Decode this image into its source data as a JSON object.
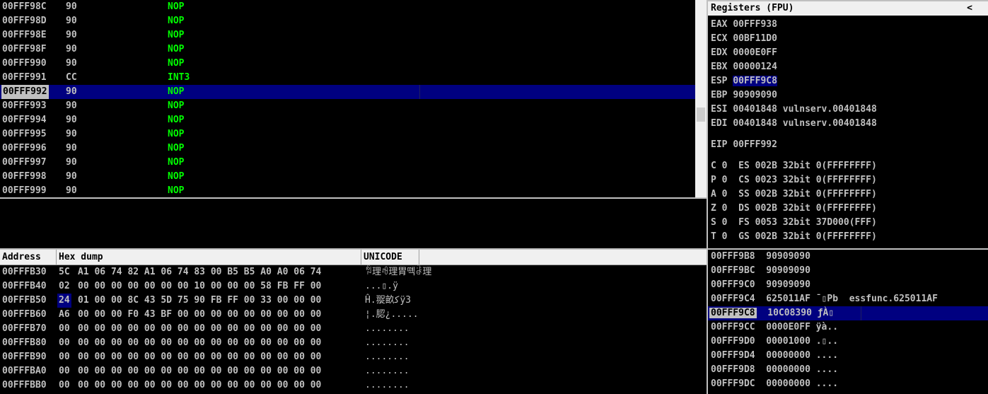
{
  "disasm": {
    "rows": [
      {
        "addr": "00FFF98C",
        "hex": "90",
        "instr": "NOP"
      },
      {
        "addr": "00FFF98D",
        "hex": "90",
        "instr": "NOP"
      },
      {
        "addr": "00FFF98E",
        "hex": "90",
        "instr": "NOP"
      },
      {
        "addr": "00FFF98F",
        "hex": "90",
        "instr": "NOP"
      },
      {
        "addr": "00FFF990",
        "hex": "90",
        "instr": "NOP"
      },
      {
        "addr": "00FFF991",
        "hex": "CC",
        "instr": "INT3"
      },
      {
        "addr": "00FFF992",
        "hex": "90",
        "instr": "NOP"
      },
      {
        "addr": "00FFF993",
        "hex": "90",
        "instr": "NOP"
      },
      {
        "addr": "00FFF994",
        "hex": "90",
        "instr": "NOP"
      },
      {
        "addr": "00FFF995",
        "hex": "90",
        "instr": "NOP"
      },
      {
        "addr": "00FFF996",
        "hex": "90",
        "instr": "NOP"
      },
      {
        "addr": "00FFF997",
        "hex": "90",
        "instr": "NOP"
      },
      {
        "addr": "00FFF998",
        "hex": "90",
        "instr": "NOP"
      },
      {
        "addr": "00FFF999",
        "hex": "90",
        "instr": "NOP"
      }
    ]
  },
  "registers": {
    "title": "Registers (FPU)",
    "collapse": "<",
    "gp": [
      {
        "name": "EAX",
        "value": "00FFF938",
        "comment": ""
      },
      {
        "name": "ECX",
        "value": "00BF11D0",
        "comment": ""
      },
      {
        "name": "EDX",
        "value": "0000E0FF",
        "comment": ""
      },
      {
        "name": "EBX",
        "value": "00000124",
        "comment": ""
      },
      {
        "name": "ESP",
        "value": "00FFF9C8",
        "comment": ""
      },
      {
        "name": "EBP",
        "value": "90909090",
        "comment": ""
      },
      {
        "name": "ESI",
        "value": "00401848",
        "comment": "vulnserv.00401848"
      },
      {
        "name": "EDI",
        "value": "00401848",
        "comment": "vulnserv.00401848"
      }
    ],
    "eip": {
      "name": "EIP",
      "value": "00FFF992"
    },
    "flags": [
      {
        "flag": "C",
        "fval": "0",
        "seg": "ES",
        "sval": "002B",
        "bits": "32bit",
        "range": "0(FFFFFFFF)"
      },
      {
        "flag": "P",
        "fval": "0",
        "seg": "CS",
        "sval": "0023",
        "bits": "32bit",
        "range": "0(FFFFFFFF)"
      },
      {
        "flag": "A",
        "fval": "0",
        "seg": "SS",
        "sval": "002B",
        "bits": "32bit",
        "range": "0(FFFFFFFF)"
      },
      {
        "flag": "Z",
        "fval": "0",
        "seg": "DS",
        "sval": "002B",
        "bits": "32bit",
        "range": "0(FFFFFFFF)"
      },
      {
        "flag": "S",
        "fval": "0",
        "seg": "FS",
        "sval": "0053",
        "bits": "32bit",
        "range": "37D000(FFF)"
      },
      {
        "flag": "T",
        "fval": "0",
        "seg": "GS",
        "sval": "002B",
        "bits": "32bit",
        "range": "0(FFFFFFFF)"
      }
    ]
  },
  "dump": {
    "headers": {
      "address": "Address",
      "hex": "Hex dump",
      "unicode": "UNICODE"
    },
    "rows": [
      {
        "addr": "00FFFB30",
        "first": "5C",
        "rest": "A1 06 74 82 A1 06 74 83 00 B5 B5 A0 A0 06 74",
        "uni": "ꅜ理ꆂ理胃뗵ꂠ理"
      },
      {
        "addr": "00FFFB40",
        "first": "02",
        "rest": "00 00 00 00 00 00 00 10 00 00 00 58 FB FF 00",
        "uni": "...▯.ÿ"
      },
      {
        "addr": "00FFFB50",
        "first": "24",
        "rest": "01 00 00 8C 43 5D 75 90 FB FF 00 33 00 00 00",
        "uni": "Ĥ.䎌畝ﮐÿ3"
      },
      {
        "addr": "00FFFB60",
        "first": "A6",
        "rest": "00 00 00 F0 43 BF 00 00 00 00 00 00 00 00 00",
        "uni": "¦.䏰¿....."
      },
      {
        "addr": "00FFFB70",
        "first": "00",
        "rest": "00 00 00 00 00 00 00 00 00 00 00 00 00 00 00",
        "uni": "........"
      },
      {
        "addr": "00FFFB80",
        "first": "00",
        "rest": "00 00 00 00 00 00 00 00 00 00 00 00 00 00 00",
        "uni": "........"
      },
      {
        "addr": "00FFFB90",
        "first": "00",
        "rest": "00 00 00 00 00 00 00 00 00 00 00 00 00 00 00",
        "uni": "........"
      },
      {
        "addr": "00FFFBA0",
        "first": "00",
        "rest": "00 00 00 00 00 00 00 00 00 00 00 00 00 00 00",
        "uni": "........"
      },
      {
        "addr": "00FFFBB0",
        "first": "00",
        "rest": "00 00 00 00 00 00 00 00 00 00 00 00 00 00 00",
        "uni": "........"
      }
    ]
  },
  "stack": {
    "rows": [
      {
        "addr": "00FFF9B8",
        "value": "90909090",
        "comment": ""
      },
      {
        "addr": "00FFF9BC",
        "value": "90909090",
        "comment": ""
      },
      {
        "addr": "00FFF9C0",
        "value": "90909090",
        "comment": ""
      },
      {
        "addr": "00FFF9C4",
        "value": "625011AF",
        "comment": "¯▯Pb  essfunc.625011AF"
      },
      {
        "addr": "00FFF9C8",
        "value": "10C08390",
        "comment": "ƒÀ▯"
      },
      {
        "addr": "00FFF9CC",
        "value": "0000E0FF",
        "comment": "ÿà.."
      },
      {
        "addr": "00FFF9D0",
        "value": "00001000",
        "comment": ".▯.."
      },
      {
        "addr": "00FFF9D4",
        "value": "00000000",
        "comment": "...."
      },
      {
        "addr": "00FFF9D8",
        "value": "00000000",
        "comment": "...."
      },
      {
        "addr": "00FFF9DC",
        "value": "00000000",
        "comment": "...."
      }
    ]
  }
}
